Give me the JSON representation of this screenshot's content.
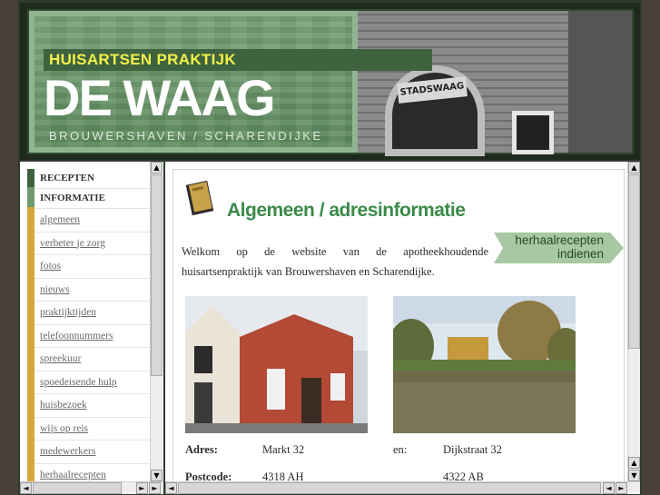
{
  "header": {
    "subtitle": "HUISARTSEN PRAKTIJK",
    "title": "DE WAAG",
    "location": "BROUWERSHAVEN / SCHARENDIJKE",
    "photo_sign": "STADSWAAG",
    "colors": {
      "subtitle": "#f2f14a",
      "title": "#ffffff",
      "green": "#5f8c5f"
    }
  },
  "sidebar": {
    "headers": [
      "RECEPTEN",
      "INFORMATIE"
    ],
    "items": [
      "algemeen",
      "verbeter je zorg",
      "fotos",
      "nieuws",
      "praktijktijden",
      "telefoonnummers",
      "spreekuur",
      "spoedeisende hulp",
      "huisbezoek",
      "wijs op reis",
      "medewerkers",
      "herhaalrecepten"
    ]
  },
  "main": {
    "title": "Algemeen / adresinformatie",
    "welcome": "Welkom op de website van de apotheekhoudende huisartsenpraktijk van Brouwershaven en Scharendijke.",
    "cta": {
      "line1": "herhaalrecepten",
      "line2": "indienen"
    },
    "address": {
      "adres_label": "Adres:",
      "adres_value": "Markt 32",
      "en_label": "en:",
      "en_value": "Dijkstraat 32",
      "postcode_label": "Postcode:",
      "postcode_value1": "4318 AH",
      "postcode_value2": "4322 AB"
    },
    "accent_color": "#3b8a4a"
  },
  "scrollbars": {
    "up": "▲",
    "down": "▼",
    "left": "◄",
    "right": "►"
  }
}
